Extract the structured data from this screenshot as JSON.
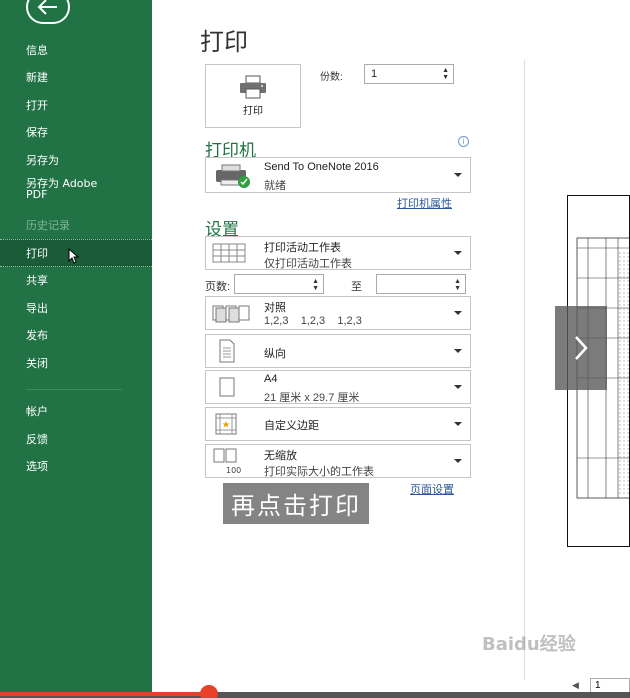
{
  "sidebar": {
    "items": [
      {
        "label": "信息"
      },
      {
        "label": "新建"
      },
      {
        "label": "打开"
      },
      {
        "label": "保存"
      },
      {
        "label": "另存为"
      },
      {
        "label": "另存为 Adobe PDF"
      },
      {
        "label": "历史记录"
      },
      {
        "label": "打印"
      },
      {
        "label": "共享"
      },
      {
        "label": "导出"
      },
      {
        "label": "发布"
      },
      {
        "label": "关闭"
      }
    ],
    "bottom_items": [
      {
        "label": "帐户"
      },
      {
        "label": "反馈"
      },
      {
        "label": "选项"
      }
    ]
  },
  "main": {
    "title": "打印",
    "print_button_label": "打印",
    "copies_label": "份数:",
    "copies_value": "1",
    "printer_section": "打印机",
    "printer_name": "Send To OneNote 2016",
    "printer_status": "就绪",
    "printer_properties_link": "打印机属性",
    "settings_section": "设置",
    "print_what": {
      "l1": "打印活动工作表",
      "l2": "仅打印活动工作表"
    },
    "pages_label": "页数:",
    "to_label": "至",
    "collate": {
      "l1": "对照",
      "l2": "1,2,3    1,2,3    1,2,3"
    },
    "orientation": {
      "l1": "纵向"
    },
    "paper": {
      "l1": "A4",
      "l2": "21 厘米 x 29.7 厘米"
    },
    "margins": {
      "l1": "自定义边距"
    },
    "scaling": {
      "l1": "无缩放",
      "l2": "打印实际大小的工作表"
    },
    "page_setup_link": "页面设置",
    "overlay_caption": "再点击打印"
  },
  "preview": {
    "page_number": "1"
  },
  "watermark": "Baidu经验",
  "colors": {
    "sidebar": "#217346",
    "accent": "#217346",
    "link": "#2b579a"
  }
}
